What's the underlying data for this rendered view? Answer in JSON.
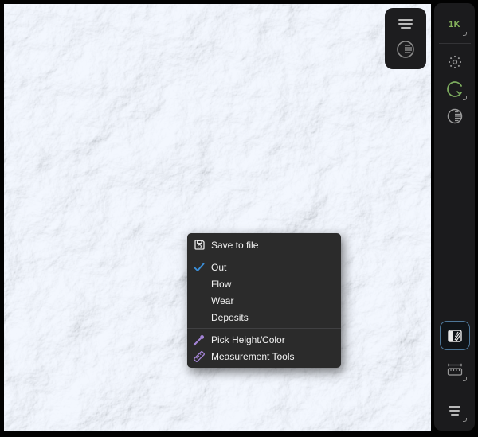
{
  "colors": {
    "accent_blue": "#3b8fd9",
    "accent_purple": "#a484d6",
    "accent_green": "#7cab5e",
    "selected_border": "#4d7596",
    "menu_bg": "#2b2b2b",
    "panel_bg": "#1d1d1f",
    "sidebar_bg": "#1b1b1d"
  },
  "viewport_toolbar": {
    "icons": [
      "hamburger-icon",
      "shaded-sphere-icon"
    ]
  },
  "context_menu": {
    "items": [
      {
        "label": "Save to file",
        "icon": "save-icon",
        "checked": false
      },
      {
        "label": "Out",
        "icon": "check-icon",
        "checked": true
      },
      {
        "label": "Flow",
        "icon": "",
        "checked": false
      },
      {
        "label": "Wear",
        "icon": "",
        "checked": false
      },
      {
        "label": "Deposits",
        "icon": "",
        "checked": false
      },
      {
        "label": "Pick Height/Color",
        "icon": "eyedropper-icon",
        "checked": false
      },
      {
        "label": "Measurement Tools",
        "icon": "measure-ruler-icon",
        "checked": false
      }
    ]
  },
  "sidebar": {
    "resolution": "1K",
    "top_icons": [
      "sun-icon",
      "light-ring-icon",
      "contrast-icon"
    ],
    "bottom_icons": [
      "material-preview-icon",
      "ruler-icon",
      "menu-lines-icon"
    ],
    "selected_icon": "material-preview-icon"
  }
}
